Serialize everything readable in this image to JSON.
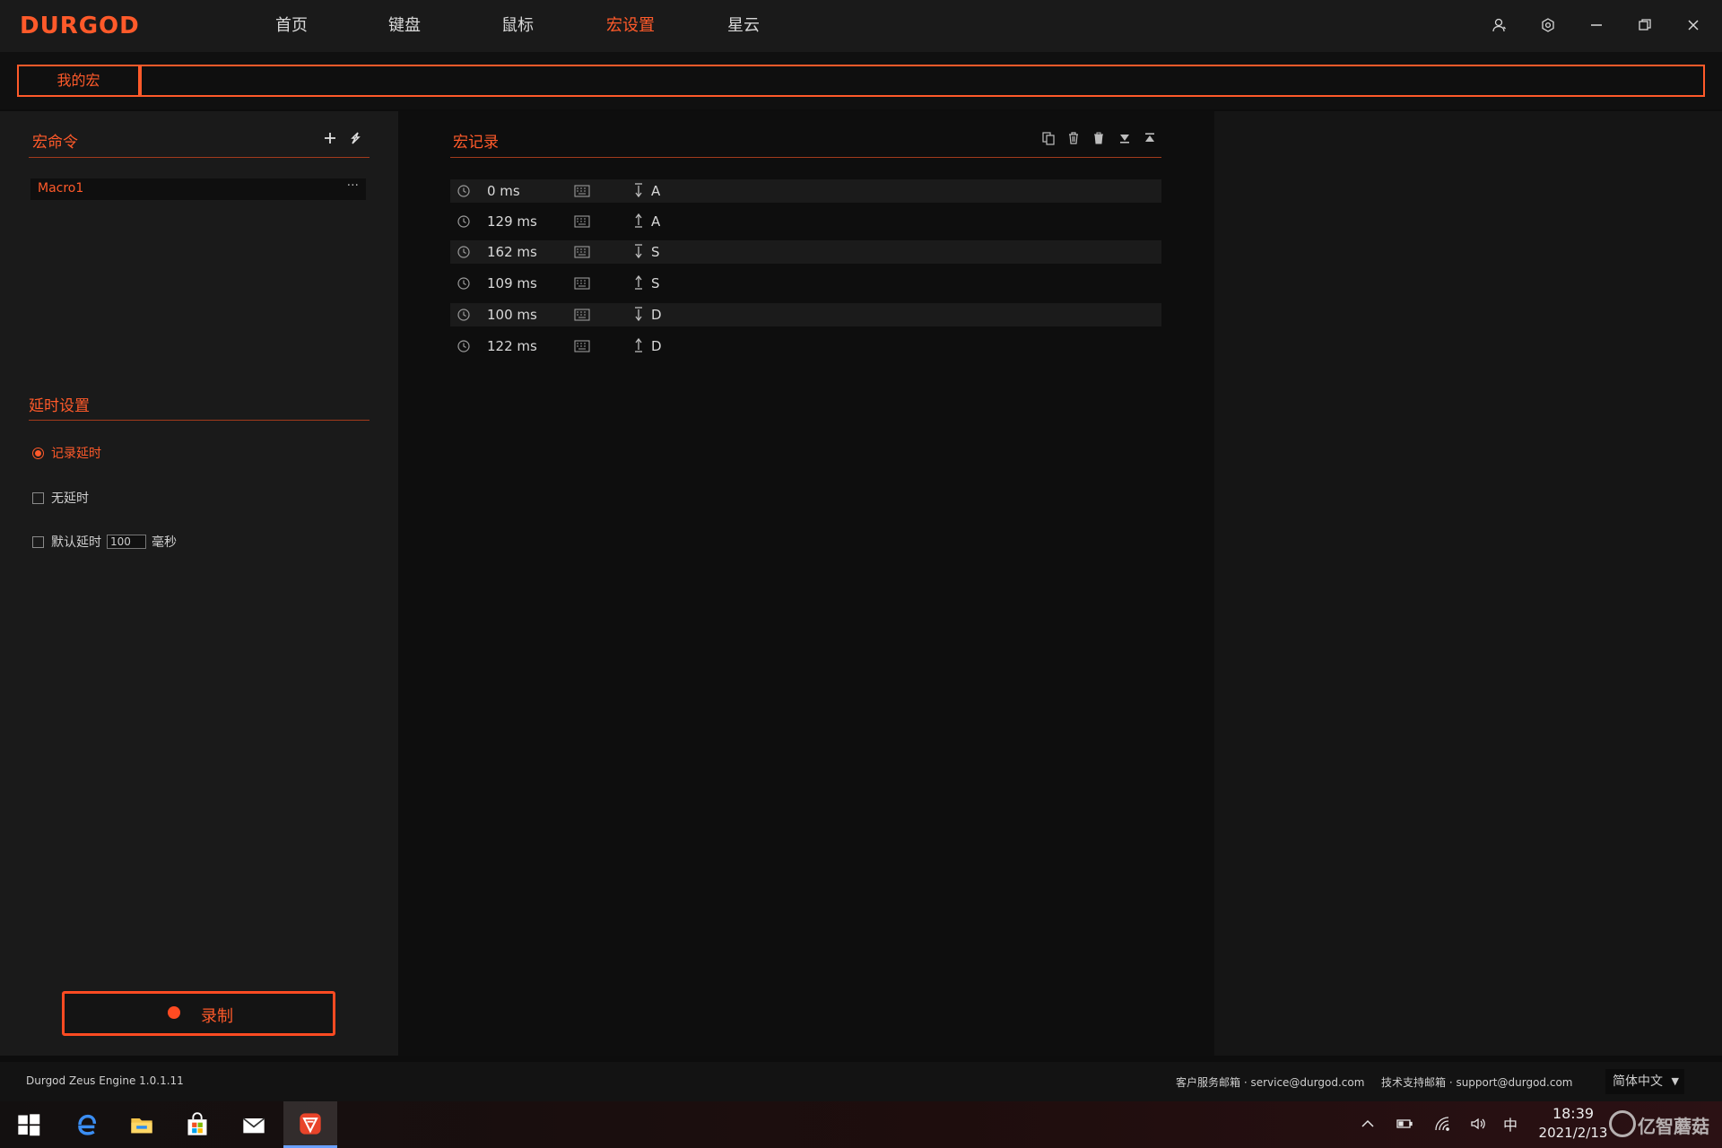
{
  "app": {
    "logo": "DURGOD",
    "nav": [
      {
        "label": "首页",
        "active": false
      },
      {
        "label": "键盘",
        "active": false
      },
      {
        "label": "鼠标",
        "active": false
      },
      {
        "label": "宏设置",
        "active": true
      },
      {
        "label": "星云",
        "active": false
      }
    ],
    "window_icons": [
      "user-icon",
      "settings-icon",
      "minimize-icon",
      "restore-icon",
      "close-icon"
    ]
  },
  "subbar": {
    "tab_label": "我的宏",
    "field_value": ""
  },
  "macro_commands": {
    "title": "宏命令",
    "items": [
      {
        "name": "Macro1",
        "more": "···"
      }
    ]
  },
  "delay_settings": {
    "title": "延时设置",
    "options": [
      {
        "label": "记录延时",
        "type": "radio",
        "checked": true
      },
      {
        "label": "无延时",
        "type": "checkbox",
        "checked": false
      },
      {
        "label": "默认延时",
        "type": "checkbox",
        "checked": false,
        "value": "100",
        "unit": "毫秒"
      }
    ]
  },
  "record_button": {
    "label": "录制"
  },
  "macro_records": {
    "title": "宏记录",
    "toolbar_icons": [
      "copy-icon",
      "delete-icon",
      "delete-all-icon",
      "move-down-icon",
      "move-up-icon"
    ],
    "rows": [
      {
        "time": "0 ms",
        "action": "down",
        "key": "A"
      },
      {
        "time": "129 ms",
        "action": "up",
        "key": "A"
      },
      {
        "time": "162 ms",
        "action": "down",
        "key": "S"
      },
      {
        "time": "109 ms",
        "action": "up",
        "key": "S"
      },
      {
        "time": "100 ms",
        "action": "down",
        "key": "D"
      },
      {
        "time": "122 ms",
        "action": "up",
        "key": "D"
      }
    ]
  },
  "footer": {
    "version": "Durgod Zeus Engine 1.0.1.11",
    "service_email": "客户服务邮箱 · service@durgod.com",
    "support_email": "技术支持邮箱 · support@durgod.com",
    "language": "简体中文"
  },
  "taskbar": {
    "apps": [
      "windows-start-icon",
      "edge-icon",
      "file-explorer-icon",
      "store-icon",
      "mail-icon",
      "durgod-app-icon"
    ],
    "tray_ime": "中",
    "time": "18:39",
    "date": "2021/2/13",
    "watermark": "亿智蘑菇"
  },
  "colors": {
    "accent": "#ff5a2a",
    "background": "#0d0d0d",
    "panel": "#1a1a1a"
  }
}
